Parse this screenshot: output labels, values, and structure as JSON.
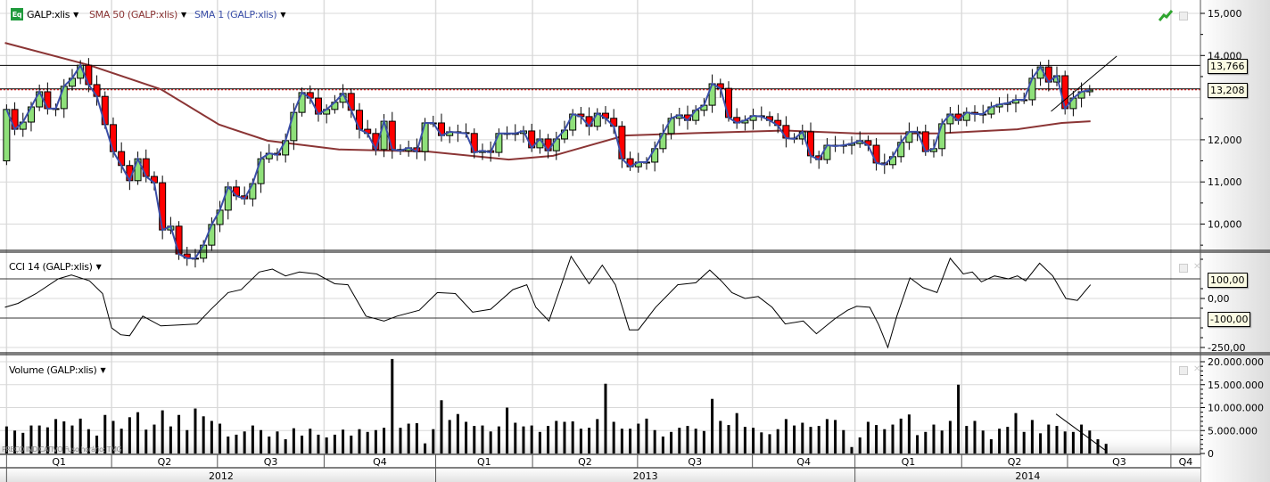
{
  "legend": {
    "main_series": "GALP:xlis",
    "sma50_label": "SMA 50 (GALP:xlis)",
    "sma1_label": "SMA 1 (GALP:xlis)",
    "cci_label": "CCI 14 (GALP:xlis)",
    "volume_label": "Volume (GALP:xlis)",
    "eq_icon_text": "Eq"
  },
  "watermark": "PREÇO INDICATIVO   Fuso horário: TMG",
  "colors": {
    "up": "#8fe07a",
    "down": "#ff0000",
    "sma50": "#8b3535",
    "sma1": "#3b4fa8",
    "cci_upper": "#cc0000",
    "cci_lower": "#006600"
  },
  "chart_data": {
    "type": "candlestick",
    "x_unit": "week index (weekly candles, week 0 = first week of 2012)",
    "x_range": [
      -0.8,
      145.5
    ],
    "quarters": [
      {
        "label": "Q1",
        "start": 0,
        "end": 12.8
      },
      {
        "label": "Q2",
        "start": 12.8,
        "end": 25.7
      },
      {
        "label": "Q3",
        "start": 25.7,
        "end": 38.7
      },
      {
        "label": "Q4",
        "start": 38.7,
        "end": 52.3
      },
      {
        "label": "Q1",
        "start": 52.3,
        "end": 64.1
      },
      {
        "label": "Q2",
        "start": 64.1,
        "end": 76.9
      },
      {
        "label": "Q3",
        "start": 76.9,
        "end": 90.9
      },
      {
        "label": "Q4",
        "start": 90.9,
        "end": 103.4
      },
      {
        "label": "Q1",
        "start": 103.4,
        "end": 116.4
      },
      {
        "label": "Q2",
        "start": 116.4,
        "end": 129.3
      },
      {
        "label": "Q3",
        "start": 129.3,
        "end": 141.9
      },
      {
        "label": "Q4",
        "start": 141.9,
        "end": 145.5
      }
    ],
    "years": [
      {
        "label": "2012",
        "start": 0,
        "end": 52.3
      },
      {
        "label": "2013",
        "start": 52.3,
        "end": 103.4
      },
      {
        "label": "2014",
        "start": 103.4,
        "end": 145.5
      }
    ],
    "price": {
      "ylim": [
        9.35,
        15.3
      ],
      "ticks": [
        {
          "v": 15,
          "label": "15,000"
        },
        {
          "v": 14,
          "label": "14,000"
        },
        {
          "v": 12,
          "label": "12,000"
        },
        {
          "v": 11,
          "label": "11,000"
        },
        {
          "v": 10,
          "label": "10,000"
        }
      ],
      "closes": [
        12.72,
        12.25,
        12.42,
        12.78,
        13.14,
        12.74,
        12.74,
        13.27,
        13.46,
        13.77,
        13.31,
        13.03,
        12.36,
        11.72,
        11.39,
        11.03,
        11.55,
        11.13,
        10.98,
        9.86,
        9.95,
        9.29,
        9.19,
        9.19,
        9.5,
        9.99,
        10.33,
        10.88,
        10.67,
        10.6,
        10.96,
        11.55,
        11.68,
        11.64,
        11.98,
        12.65,
        13.12,
        12.99,
        12.61,
        12.72,
        12.89,
        13.1,
        12.7,
        12.25,
        12.15,
        11.77,
        12.44,
        11.77,
        11.74,
        11.81,
        11.72,
        12.4,
        12.4,
        12.1,
        12.19,
        12.17,
        12.15,
        11.7,
        11.74,
        11.7,
        12.15,
        12.15,
        12.15,
        12.21,
        11.81,
        12.02,
        11.74,
        12.02,
        12.23,
        12.61,
        12.55,
        12.32,
        12.63,
        12.51,
        12.32,
        11.55,
        11.36,
        11.47,
        11.47,
        11.79,
        12.15,
        12.51,
        12.59,
        12.46,
        12.7,
        12.82,
        13.33,
        13.22,
        12.53,
        12.4,
        12.46,
        12.57,
        12.55,
        12.46,
        12.34,
        12.04,
        12.02,
        12.19,
        11.62,
        11.53,
        11.87,
        11.85,
        11.87,
        11.91,
        11.98,
        11.87,
        11.45,
        11.41,
        11.6,
        11.94,
        12.19,
        12.19,
        11.72,
        11.79,
        12.38,
        12.61,
        12.46,
        12.65,
        12.61,
        12.61,
        12.78,
        12.84,
        12.87,
        12.95,
        12.95,
        13.46,
        13.73,
        13.37,
        13.52,
        12.74,
        12.99,
        13.14,
        13.18
      ],
      "first_open": 11.5,
      "sma50": [
        [
          -0.2,
          14.3
        ],
        [
          10.1,
          13.77
        ],
        [
          18.8,
          13.2
        ],
        [
          25.9,
          12.36
        ],
        [
          31.8,
          11.98
        ],
        [
          40.5,
          11.77
        ],
        [
          51.4,
          11.72
        ],
        [
          61.2,
          11.53
        ],
        [
          66.6,
          11.62
        ],
        [
          75.3,
          12.1
        ],
        [
          84.0,
          12.16
        ],
        [
          94.9,
          12.22
        ],
        [
          103.6,
          12.15
        ],
        [
          113.4,
          12.15
        ],
        [
          123.2,
          12.25
        ],
        [
          128.6,
          12.4
        ],
        [
          132.1,
          12.44
        ]
      ],
      "hlines": [
        {
          "value": 13.766,
          "label": "13,766",
          "style": "solid"
        },
        {
          "value": 13.208,
          "label": "13,208",
          "style": "dotted"
        }
      ],
      "trendline": [
        [
          127.3,
          12.675
        ],
        [
          135.3,
          13.985
        ]
      ]
    },
    "cci": {
      "ylim": [
        -260,
        230
      ],
      "ticks": [
        {
          "v": 0,
          "label": "0,00"
        },
        {
          "v": -250,
          "label": "-250,00"
        }
      ],
      "levels": [
        {
          "value": 100,
          "label": "100,00"
        },
        {
          "value": -100,
          "label": "-100,00"
        }
      ],
      "points": [
        [
          -0.2,
          -45
        ],
        [
          1.4,
          -25
        ],
        [
          3.6,
          25
        ],
        [
          6.3,
          100
        ],
        [
          7.9,
          120
        ],
        [
          10.1,
          90
        ],
        [
          11.7,
          25
        ],
        [
          12.8,
          -150
        ],
        [
          13.9,
          -185
        ],
        [
          15.0,
          -190
        ],
        [
          16.6,
          -90
        ],
        [
          18.8,
          -140
        ],
        [
          21.0,
          -135
        ],
        [
          23.2,
          -130
        ],
        [
          24.8,
          -60
        ],
        [
          27.0,
          30
        ],
        [
          28.6,
          45
        ],
        [
          30.8,
          135
        ],
        [
          32.4,
          150
        ],
        [
          34.0,
          115
        ],
        [
          35.7,
          135
        ],
        [
          37.8,
          125
        ],
        [
          40.0,
          75
        ],
        [
          41.6,
          70
        ],
        [
          43.8,
          -90
        ],
        [
          46.0,
          -115
        ],
        [
          47.6,
          -90
        ],
        [
          50.3,
          -60
        ],
        [
          52.5,
          30
        ],
        [
          54.7,
          25
        ],
        [
          56.8,
          -70
        ],
        [
          59.0,
          -55
        ],
        [
          61.7,
          45
        ],
        [
          63.4,
          70
        ],
        [
          64.5,
          -45
        ],
        [
          66.1,
          -115
        ],
        [
          68.8,
          215
        ],
        [
          71.0,
          75
        ],
        [
          72.6,
          170
        ],
        [
          74.2,
          70
        ],
        [
          75.9,
          -160
        ],
        [
          77.0,
          -160
        ],
        [
          79.1,
          -45
        ],
        [
          81.8,
          70
        ],
        [
          84.0,
          80
        ],
        [
          85.7,
          145
        ],
        [
          87.1,
          90
        ],
        [
          88.4,
          30
        ],
        [
          90.0,
          0
        ],
        [
          91.6,
          10
        ],
        [
          93.3,
          -45
        ],
        [
          94.9,
          -130
        ],
        [
          97.1,
          -115
        ],
        [
          98.7,
          -180
        ],
        [
          100.9,
          -105
        ],
        [
          102.5,
          -60
        ],
        [
          103.6,
          -40
        ],
        [
          105.2,
          -45
        ],
        [
          106.3,
          -135
        ],
        [
          107.4,
          -250
        ],
        [
          108.5,
          -90
        ],
        [
          110.1,
          105
        ],
        [
          111.7,
          55
        ],
        [
          113.4,
          30
        ],
        [
          115.0,
          205
        ],
        [
          116.6,
          125
        ],
        [
          117.7,
          135
        ],
        [
          118.8,
          85
        ],
        [
          120.4,
          115
        ],
        [
          122.1,
          100
        ],
        [
          123.2,
          115
        ],
        [
          124.2,
          90
        ],
        [
          125.9,
          180
        ],
        [
          127.5,
          115
        ],
        [
          129.1,
          0
        ],
        [
          130.5,
          -10
        ],
        [
          132.1,
          70
        ]
      ]
    },
    "volume": {
      "unit": "shares (millions)",
      "ylim": [
        0,
        20.6
      ],
      "ticks": [
        {
          "v": 20,
          "label": "20.000.000"
        },
        {
          "v": 15,
          "label": "15.000.000"
        },
        {
          "v": 10,
          "label": "10.000.000"
        },
        {
          "v": 5,
          "label": "5.000.000"
        },
        {
          "v": 0,
          "label": "0"
        }
      ],
      "values": [
        5.9,
        5.0,
        4.5,
        6.1,
        6.1,
        5.7,
        7.5,
        7.0,
        6.1,
        7.6,
        5.3,
        3.9,
        8.4,
        7.1,
        5.4,
        7.9,
        9.0,
        5.2,
        6.3,
        9.4,
        5.9,
        8.4,
        5.1,
        9.8,
        8.1,
        7.1,
        6.5,
        3.7,
        4.1,
        4.8,
        6.1,
        5.1,
        3.7,
        4.8,
        3.1,
        5.5,
        3.9,
        5.4,
        4.1,
        3.5,
        4.1,
        5.2,
        3.9,
        5.3,
        4.7,
        5.1,
        5.6,
        20.6,
        5.6,
        6.5,
        6.6,
        2.2,
        5.3,
        11.6,
        7.3,
        8.6,
        6.9,
        6.0,
        6.1,
        4.8,
        5.9,
        10.0,
        6.7,
        5.9,
        6.1,
        4.7,
        6.0,
        7.1,
        6.9,
        7.0,
        5.4,
        5.6,
        7.5,
        15.2,
        6.9,
        5.4,
        5.4,
        6.5,
        7.6,
        5.1,
        3.7,
        4.7,
        5.6,
        6.0,
        5.4,
        4.9,
        11.9,
        7.1,
        6.2,
        8.8,
        5.8,
        5.6,
        4.6,
        4.2,
        5.3,
        7.5,
        6.1,
        6.7,
        5.8,
        6.0,
        7.5,
        7.3,
        5.1,
        1.4,
        3.5,
        6.9,
        6.2,
        5.3,
        6.3,
        7.6,
        8.5,
        4.0,
        4.7,
        6.3,
        5.0,
        7.1,
        15.0,
        6.0,
        7.1,
        5.0,
        3.1,
        5.4,
        5.8,
        8.8,
        4.7,
        7.3,
        4.4,
        6.3,
        6.0,
        4.8,
        4.7,
        6.3,
        5.0,
        3.1,
        2.1
      ],
      "trendline": [
        [
          127.9,
          8.6
        ],
        [
          134.0,
          0.6
        ]
      ]
    }
  }
}
